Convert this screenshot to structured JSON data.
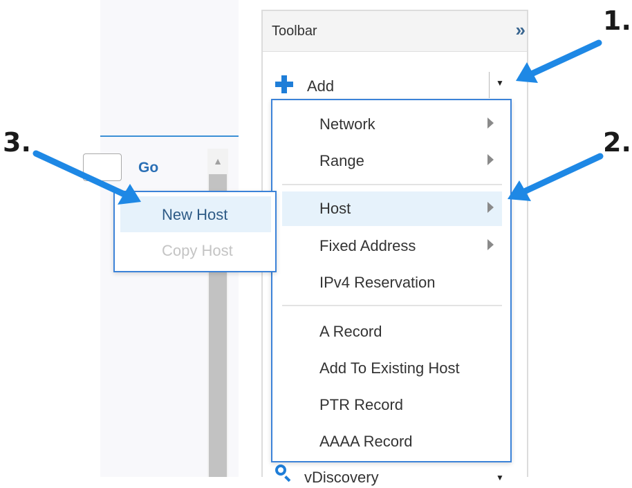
{
  "search": {
    "go_label": "Go"
  },
  "toolbar": {
    "title": "Toolbar",
    "collapse_glyph": "»",
    "add_label": "Add",
    "add_caret": "▼",
    "bottom_label": "vDiscovery",
    "bottom_caret": "▼"
  },
  "add_menu": {
    "items": [
      {
        "label": "Network",
        "has_submenu": true
      },
      {
        "label": "Range",
        "has_submenu": true
      },
      {
        "label": "Host",
        "has_submenu": true,
        "highlighted": true
      },
      {
        "label": "Fixed Address",
        "has_submenu": true
      },
      {
        "label": "IPv4 Reservation",
        "has_submenu": false
      },
      {
        "label": "A Record",
        "has_submenu": false
      },
      {
        "label": "Add To Existing Host",
        "has_submenu": false
      },
      {
        "label": "PTR Record",
        "has_submenu": false
      },
      {
        "label": "AAAA Record",
        "has_submenu": false
      }
    ]
  },
  "host_submenu": {
    "items": [
      {
        "label": "New Host",
        "highlighted": true,
        "enabled": true
      },
      {
        "label": "Copy Host",
        "highlighted": false,
        "enabled": false
      }
    ]
  },
  "annotations": {
    "step1": "1.",
    "step2": "2.",
    "step3": "3.",
    "arrow_color": "#1e88e5"
  },
  "colors": {
    "accent_blue": "#1f7ed8",
    "menu_border": "#3b82d8",
    "highlight_bg": "#e6f2fb",
    "link_blue": "#2a6fb5"
  },
  "icons": [
    "double-chevron-right-icon",
    "plus-icon",
    "caret-down-icon",
    "submenu-arrow-icon",
    "magnifier-icon",
    "scroll-up-arrow-icon"
  ]
}
